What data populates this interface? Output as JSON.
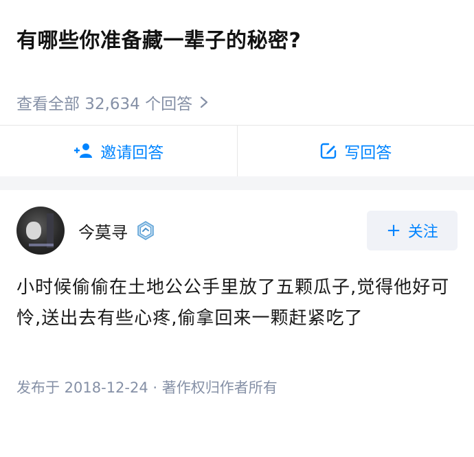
{
  "question": {
    "title": "有哪些你准备藏一辈子的秘密?",
    "view_all": "查看全部 32,634 个回答"
  },
  "actions": {
    "invite": "邀请回答",
    "write": "写回答"
  },
  "answer": {
    "author": "今莫寻",
    "follow": "关注",
    "content": "小时候偷偷在土地公公手里放了五颗瓜子,觉得他好可怜,送出去有些心疼,偷拿回来一颗赶紧吃了",
    "meta": "发布于 2018-12-24 · 著作权归作者所有"
  },
  "colors": {
    "accent": "#0084ff",
    "muted": "#8590a6",
    "divider_bg": "#f4f5f7"
  },
  "icons": {
    "view_all_chevron": "chevron-right-icon",
    "invite": "add-user-icon",
    "write": "edit-icon",
    "verified": "verified-badge-icon"
  }
}
